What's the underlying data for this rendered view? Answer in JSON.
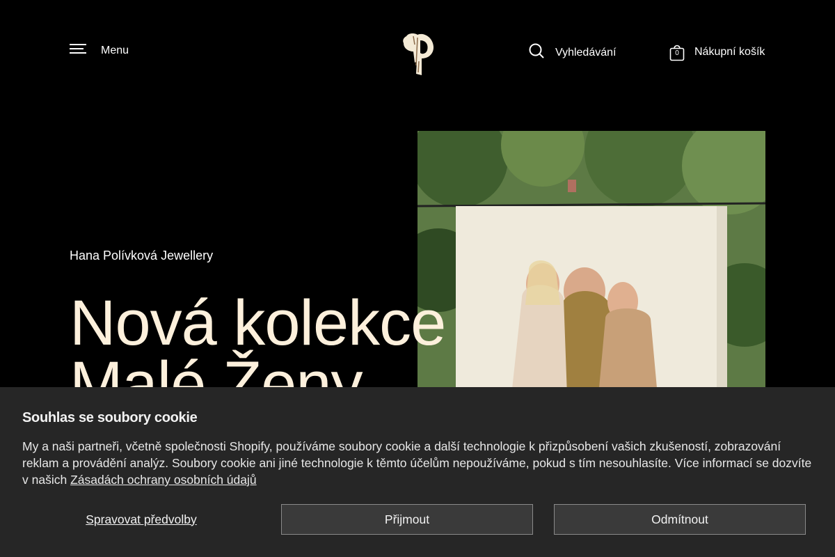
{
  "header": {
    "menu_label": "Menu",
    "search_label": "Vyhledávání",
    "cart_label": "Nákupní košík",
    "cart_count": "0"
  },
  "hero": {
    "brand": "Hana Polívková Jewellery",
    "title_line1": "Nová kolekce",
    "title_line2": "Malé Ženy"
  },
  "cookie": {
    "title": "Souhlas se soubory cookie",
    "text": "My a naši partneři, včetně společnosti Shopify, používáme soubory cookie a další technologie k přizpůsobení vašich zkušeností, zobrazování reklam a provádění analýz. Soubory cookie ani jiné technologie k těmto účelům nepoužíváme, pokud s tím nesouhlasíte. Více informací se dozvíte v našich ",
    "policy_link": "Zásadách ochrany osobních údajů",
    "manage_label": "Spravovat předvolby",
    "accept_label": "Přijmout",
    "decline_label": "Odmítnout"
  },
  "colors": {
    "background": "#000000",
    "title_cream": "#fdf0dc",
    "banner_bg": "#262626"
  }
}
